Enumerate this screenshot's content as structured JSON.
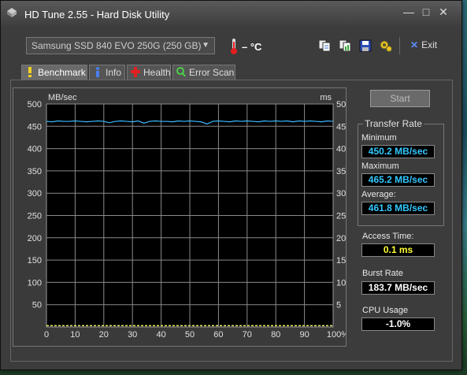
{
  "window": {
    "title": "HD Tune 2.55 - Hard Disk Utility",
    "controls": {
      "minimize": "—",
      "maximize": "□",
      "close": "✕"
    }
  },
  "toolbar": {
    "drive": "Samsung SSD 840 EVO 250G (250 GB)",
    "temperature": "– °C",
    "exit_label": "Exit"
  },
  "tabs": [
    {
      "label": "Benchmark",
      "icon": "benchmark-icon",
      "active": true
    },
    {
      "label": "Info",
      "icon": "info-icon",
      "active": false
    },
    {
      "label": "Health",
      "icon": "health-icon",
      "active": false
    },
    {
      "label": "Error Scan",
      "icon": "error-scan-icon",
      "active": false
    }
  ],
  "benchmark": {
    "start_label": "Start",
    "transfer_rate": {
      "title": "Transfer Rate",
      "minimum_label": "Minimum",
      "minimum": "450.2 MB/sec",
      "maximum_label": "Maximum",
      "maximum": "465.2 MB/sec",
      "average_label": "Average:",
      "average": "461.8 MB/sec"
    },
    "access_time_label": "Access Time:",
    "access_time": "0.1 ms",
    "burst_rate_label": "Burst Rate",
    "burst_rate": "183.7 MB/sec",
    "cpu_usage_label": "CPU Usage",
    "cpu_usage": "-1.0%"
  },
  "chart_data": {
    "type": "line",
    "ylabel": "MB/sec",
    "y2label": "ms",
    "ylim": [
      0,
      500
    ],
    "y2lim": [
      0,
      50
    ],
    "xlim": [
      0,
      100
    ],
    "y_ticks": [
      "500",
      "450",
      "400",
      "350",
      "300",
      "250",
      "200",
      "150",
      "100",
      "50"
    ],
    "y2_ticks": [
      "50",
      "45",
      "40",
      "35",
      "30",
      "25",
      "20",
      "15",
      "10",
      "5"
    ],
    "x_ticks": [
      "0",
      "10",
      "20",
      "30",
      "40",
      "50",
      "60",
      "70",
      "80",
      "90",
      "100%"
    ],
    "grid": true,
    "colors": {
      "transfer": "#3ab8ff",
      "access": "#e8e85a",
      "grid": "#8a8a8a",
      "background": "#000000"
    },
    "series": [
      {
        "x": [
          0,
          2,
          4,
          6,
          8,
          10,
          12,
          14,
          16,
          18,
          20,
          22,
          24,
          26,
          28,
          30,
          32,
          34,
          36,
          38,
          40,
          42,
          44,
          46,
          48,
          50,
          52,
          54,
          56,
          58,
          60,
          62,
          64,
          66,
          68,
          70,
          72,
          74,
          76,
          78,
          80,
          82,
          84,
          86,
          88,
          90,
          92,
          94,
          96,
          98,
          100
        ],
        "values": [
          461,
          460,
          462,
          461,
          461,
          462,
          461,
          460,
          461,
          462,
          461,
          458,
          461,
          462,
          461,
          460,
          462,
          457,
          461,
          462,
          461,
          461,
          460,
          462,
          461,
          462,
          461,
          460,
          455,
          461,
          462,
          461,
          460,
          462,
          461,
          462,
          461,
          460,
          462,
          461,
          462,
          461,
          462,
          460,
          462,
          461,
          462,
          461,
          460,
          462,
          461
        ]
      },
      {
        "x": [
          0,
          2,
          4,
          6,
          8,
          10,
          12,
          14,
          16,
          18,
          20,
          22,
          24,
          26,
          28,
          30,
          32,
          34,
          36,
          38,
          40,
          42,
          44,
          46,
          48,
          50,
          52,
          54,
          56,
          58,
          60,
          62,
          64,
          66,
          68,
          70,
          72,
          74,
          76,
          78,
          80,
          82,
          84,
          86,
          88,
          90,
          92,
          94,
          96,
          98,
          100
        ],
        "values": [
          0.1,
          0.1,
          0.1,
          0.1,
          0.1,
          0.1,
          0.1,
          0.1,
          0.1,
          0.1,
          0.1,
          0.1,
          0.1,
          0.1,
          0.1,
          0.1,
          0.1,
          0.1,
          0.1,
          0.1,
          0.1,
          0.1,
          0.1,
          0.1,
          0.1,
          0.1,
          0.1,
          0.1,
          0.1,
          0.1,
          0.1,
          0.1,
          0.1,
          0.1,
          0.1,
          0.1,
          0.1,
          0.1,
          0.1,
          0.1,
          0.1,
          0.1,
          0.1,
          0.1,
          0.1,
          0.1,
          0.1,
          0.1,
          0.1,
          0.1,
          0.1
        ]
      }
    ]
  }
}
